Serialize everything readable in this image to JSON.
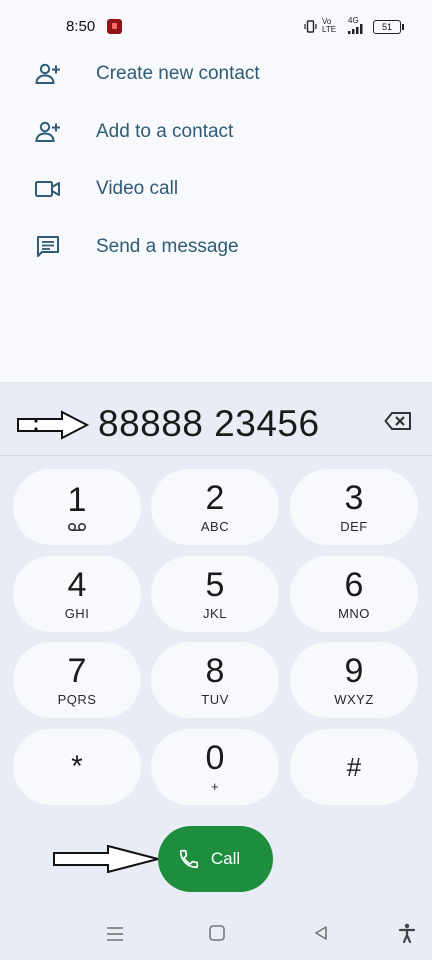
{
  "status_bar": {
    "time": "8:50",
    "network_label": "Vo LTE",
    "signal_label": "4G",
    "battery": "51"
  },
  "actions": [
    {
      "label": "Create new contact",
      "icon": "add-person-icon"
    },
    {
      "label": "Add to a contact",
      "icon": "add-person-icon"
    },
    {
      "label": "Video call",
      "icon": "video-camera-icon"
    },
    {
      "label": "Send a message",
      "icon": "message-icon"
    }
  ],
  "dialer": {
    "number": "88888 23456",
    "keys": [
      {
        "digit": "1",
        "letters": ""
      },
      {
        "digit": "2",
        "letters": "ABC"
      },
      {
        "digit": "3",
        "letters": "DEF"
      },
      {
        "digit": "4",
        "letters": "GHI"
      },
      {
        "digit": "5",
        "letters": "JKL"
      },
      {
        "digit": "6",
        "letters": "MNO"
      },
      {
        "digit": "7",
        "letters": "PQRS"
      },
      {
        "digit": "8",
        "letters": "TUV"
      },
      {
        "digit": "9",
        "letters": "WXYZ"
      },
      {
        "digit": "*",
        "letters": ""
      },
      {
        "digit": "0",
        "letters": "+"
      },
      {
        "digit": "#",
        "letters": ""
      }
    ],
    "call_label": "Call"
  },
  "colors": {
    "call_green": "#1e8e3e",
    "action_text": "#2f5b76",
    "sheet_bg": "#e8edf5",
    "key_bg": "#f8f9fd"
  }
}
